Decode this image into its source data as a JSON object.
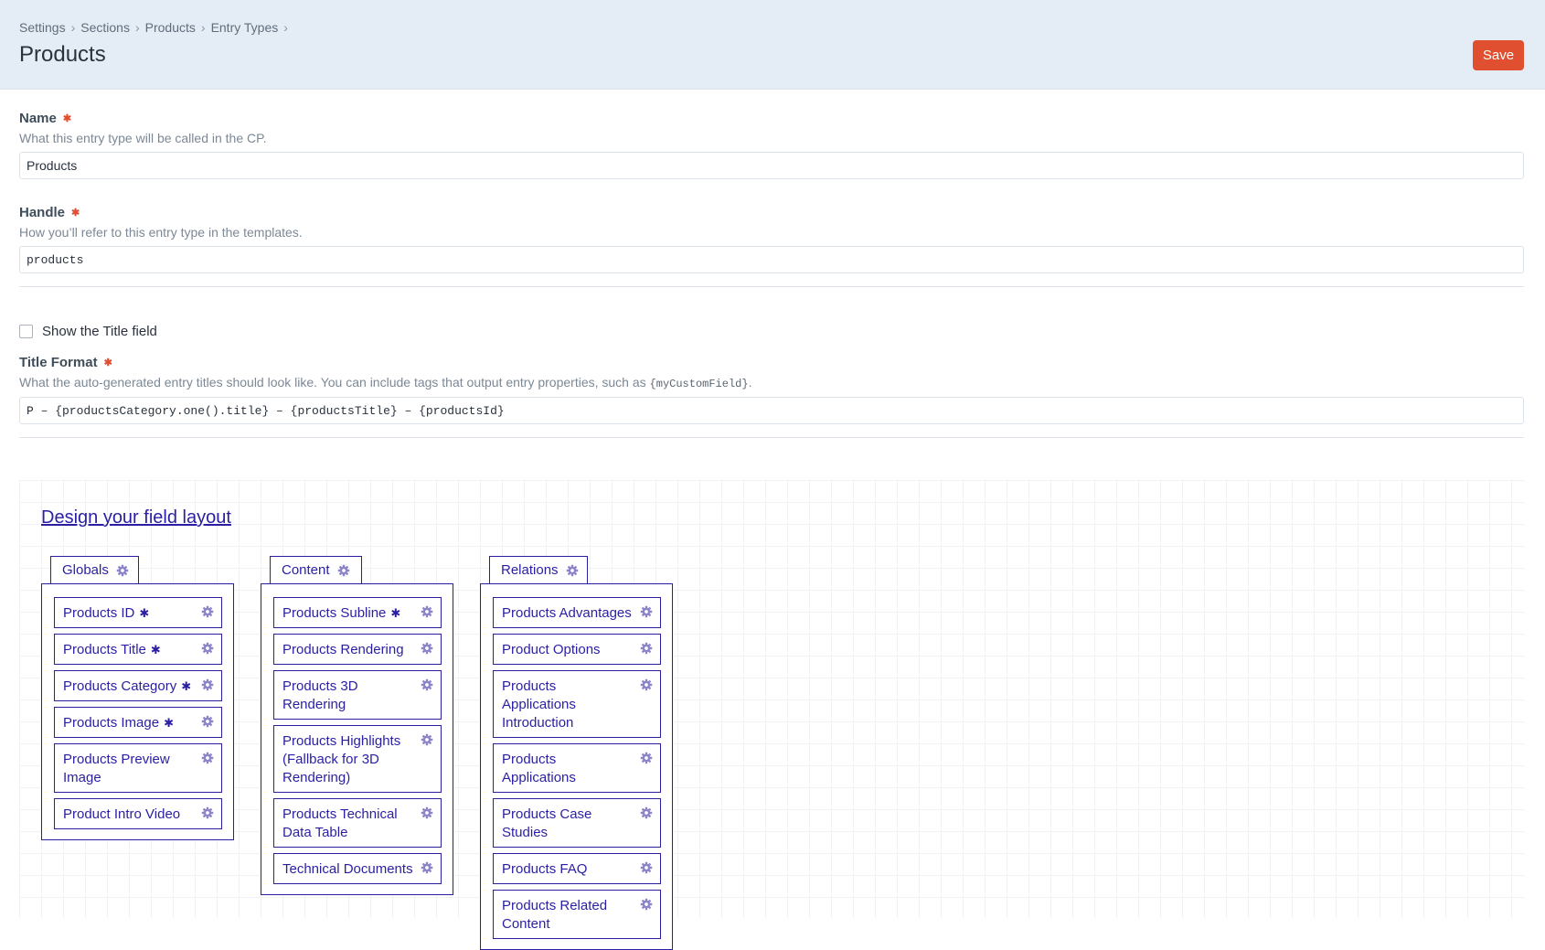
{
  "header": {
    "breadcrumbs": [
      "Settings",
      "Sections",
      "Products",
      "Entry Types"
    ],
    "title": "Products",
    "save_label": "Save"
  },
  "form": {
    "name": {
      "label": "Name",
      "instructions": "What this entry type will be called in the CP.",
      "value": "Products"
    },
    "handle": {
      "label": "Handle",
      "instructions": "How you’ll refer to this entry type in the templates.",
      "value": "products"
    },
    "show_title": {
      "label": "Show the Title field",
      "checked": false
    },
    "title_format": {
      "label": "Title Format",
      "instructions_prefix": "What the auto-generated entry titles should look like. You can include tags that output entry properties, such as ",
      "instructions_code": "{myCustomField}",
      "instructions_suffix": ".",
      "value": "P – {productsCategory.one().title} – {productsTitle} – {productsId}"
    }
  },
  "layout_designer": {
    "link_label": "Design your field layout",
    "accent_color": "#2a1fa3",
    "gear_icon": "gear-icon",
    "required_icon": "asterisk-icon",
    "tabs": [
      {
        "name": "Globals",
        "fields": [
          {
            "label": "Products ID",
            "required": true
          },
          {
            "label": "Products Title",
            "required": true
          },
          {
            "label": "Products Category",
            "required": true
          },
          {
            "label": "Products Image",
            "required": true
          },
          {
            "label": "Products Preview Image",
            "required": false
          },
          {
            "label": "Product Intro Video",
            "required": false
          }
        ]
      },
      {
        "name": "Content",
        "fields": [
          {
            "label": "Products Subline",
            "required": true
          },
          {
            "label": "Products Rendering",
            "required": false
          },
          {
            "label": "Products 3D Rendering",
            "required": false
          },
          {
            "label": "Products Highlights (Fallback for 3D Rendering)",
            "required": false
          },
          {
            "label": "Products Technical Data Table",
            "required": false
          },
          {
            "label": "Technical Documents",
            "required": false
          }
        ]
      },
      {
        "name": "Relations",
        "fields": [
          {
            "label": "Products Advantages",
            "required": false
          },
          {
            "label": "Product Options",
            "required": false
          },
          {
            "label": "Products Applications Introduction",
            "required": false
          },
          {
            "label": "Products Applications",
            "required": false
          },
          {
            "label": "Products Case Studies",
            "required": false
          },
          {
            "label": "Products FAQ",
            "required": false
          },
          {
            "label": "Products Related Content",
            "required": false
          }
        ]
      }
    ]
  }
}
